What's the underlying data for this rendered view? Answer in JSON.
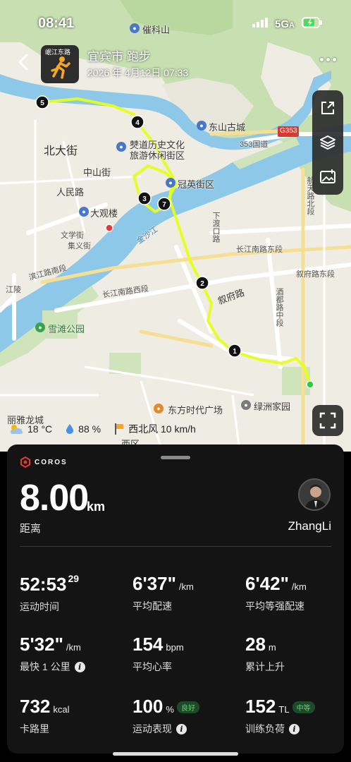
{
  "status_bar": {
    "time": "08:41",
    "network": "5G",
    "network_suffix": "A"
  },
  "header": {
    "title": "宜宾市 跑步",
    "date": "2026 年 4月12日 07:33",
    "thumb_label": "岷江东路"
  },
  "map": {
    "labels": {
      "cuiping": "催科山",
      "dongshan": "东山古城",
      "g353": "G353",
      "road353": "353国道",
      "beidajie": "北大街",
      "culture1": "僰道历史文化",
      "culture2": "旅游休闲街区",
      "guanying": "冠英街区",
      "zhongshan": "中山街",
      "renmin": "人民路",
      "daguanlou": "大观楼",
      "jinsha": "金沙江",
      "wenxue": "文学街",
      "jiuyi": "集义街",
      "binjiang": "滨江路南段",
      "changjiang": "长江南路西段",
      "changjiang_east": "长江南路东段",
      "xuetan": "雪滩公园",
      "lixia": "丽雅龙城",
      "dongfang": "东方时代广场",
      "lvzhou": "绿洲家园",
      "xufu": "叙府路",
      "xufu_east": "叙府路东段",
      "jiuduan": "酒都路中段",
      "hangtian": "航天路北段",
      "xiqu": "西区",
      "jiangling": "江陵",
      "xiada": "下渡口路"
    },
    "markers": [
      "1",
      "2",
      "3",
      "4",
      "5",
      "7"
    ]
  },
  "weather": {
    "temperature": "18 °C",
    "humidity": "88 %",
    "wind": "西北风 10 km/h"
  },
  "panel": {
    "brand": "COROS",
    "distance": "8.00",
    "distance_unit": "km",
    "distance_label": "距离",
    "username": "ZhangLi",
    "stats": {
      "moving_time": {
        "value": "52:53",
        "sup": "29",
        "label": "运动时间"
      },
      "avg_pace": {
        "value": "6'37\"",
        "unit": "/km",
        "label": "平均配速"
      },
      "avg_grade_pace": {
        "value": "6'42\"",
        "unit": "/km",
        "label": "平均等强配速"
      },
      "fastest_km": {
        "value": "5'32\"",
        "unit": "/km",
        "label": "最快 1 公里"
      },
      "avg_hr": {
        "value": "154",
        "unit": "bpm",
        "label": "平均心率"
      },
      "elevation": {
        "value": "28",
        "unit": "m",
        "label": "累计上升"
      },
      "calories": {
        "value": "732",
        "unit": "kcal",
        "label": "卡路里"
      },
      "performance": {
        "value": "100",
        "unit": "%",
        "badge": "良好",
        "label": "运动表现"
      },
      "training_load": {
        "value": "152",
        "unit": "TL",
        "badge": "中等",
        "label": "训练负荷"
      }
    }
  }
}
